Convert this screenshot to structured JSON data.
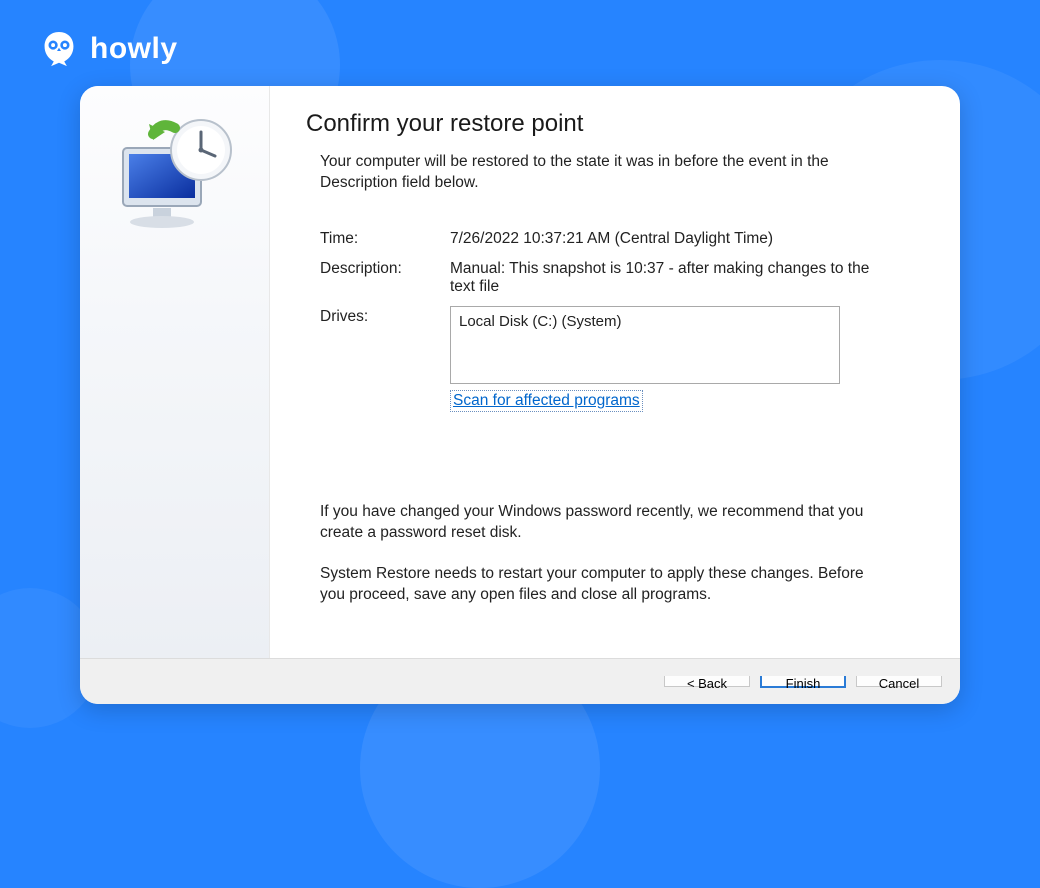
{
  "brand": {
    "name": "howly"
  },
  "dialog": {
    "title": "Confirm your restore point",
    "subtitle": "Your computer will be restored to the state it was in before the event in the Description field below.",
    "fields": {
      "time_label": "Time:",
      "time_value": "7/26/2022 10:37:21 AM (Central Daylight Time)",
      "description_label": "Description:",
      "description_value": "Manual: This snapshot is 10:37 - after making changes to the text file",
      "drives_label": "Drives:",
      "drives_value": "Local Disk (C:) (System)"
    },
    "scan_link": "Scan for affected programs",
    "note_password": "If you have changed your Windows password recently, we recommend that you create a password reset disk.",
    "note_restart": "System Restore needs to restart your computer to apply these changes. Before you proceed, save any open files and close all programs.",
    "buttons": {
      "back": "< Back",
      "finish": "Finish",
      "cancel": "Cancel"
    }
  }
}
